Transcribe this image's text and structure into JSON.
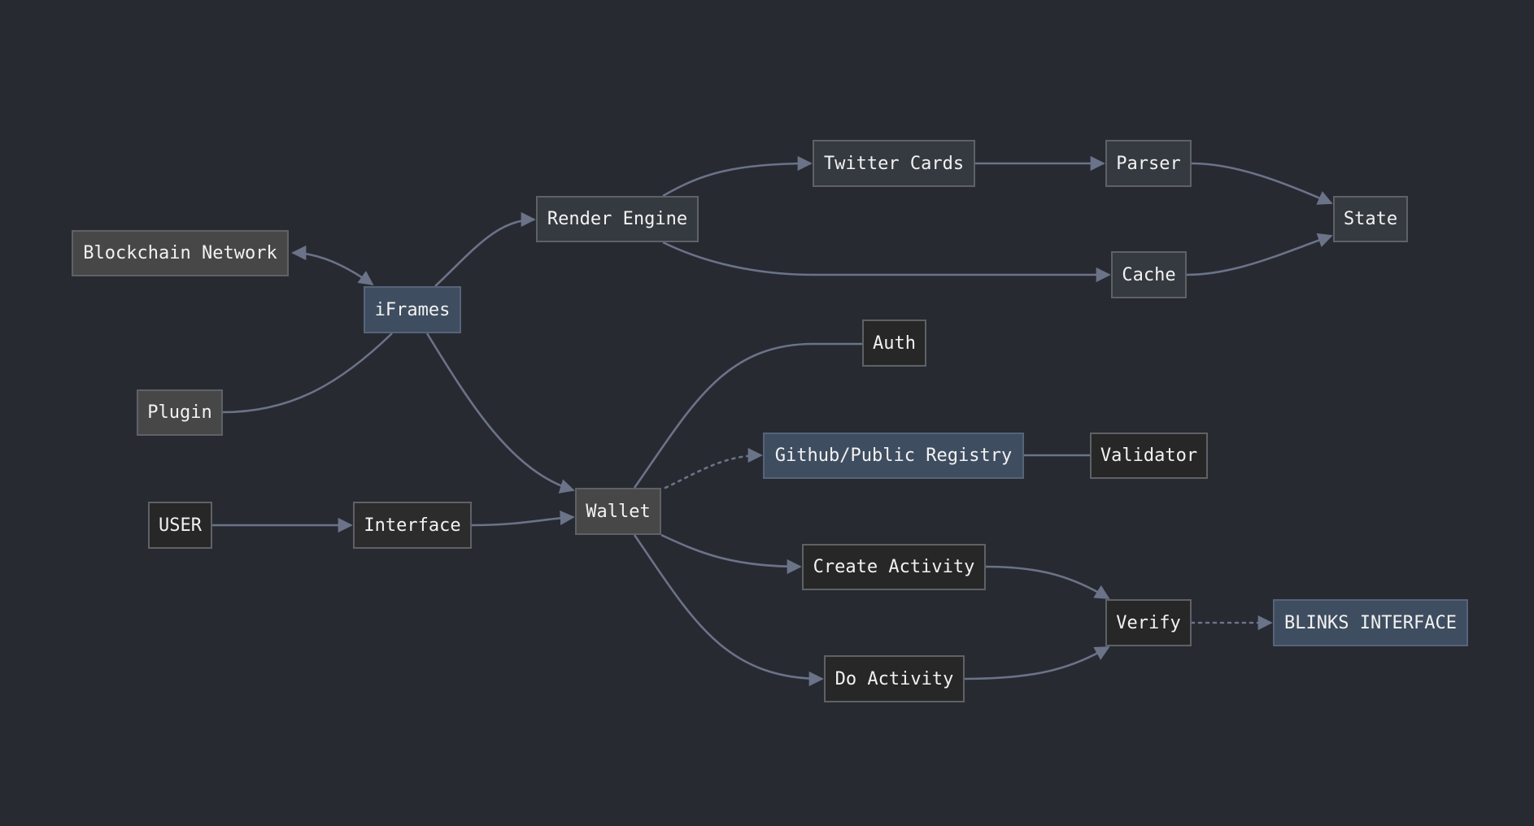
{
  "nodes": {
    "blockchain": "Blockchain Network",
    "iframes": "iFrames",
    "plugin": "Plugin",
    "user": "USER",
    "interface": "Interface",
    "wallet": "Wallet",
    "render": "Render Engine",
    "twitter": "Twitter Cards",
    "parser": "Parser",
    "state": "State",
    "cache": "Cache",
    "auth": "Auth",
    "github": "Github/Public Registry",
    "validator": "Validator",
    "create": "Create Activity",
    "verify": "Verify",
    "do": "Do Activity",
    "blinks": "BLINKS INTERFACE"
  },
  "edges": [
    {
      "from": "iFrames",
      "to": "Blockchain Network",
      "style": "solid",
      "arrow": "both"
    },
    {
      "from": "Plugin",
      "to": "iFrames",
      "style": "solid",
      "arrow": "none"
    },
    {
      "from": "iFrames",
      "to": "Render Engine",
      "style": "solid",
      "arrow": "end"
    },
    {
      "from": "iFrames",
      "to": "Wallet",
      "style": "solid",
      "arrow": "end"
    },
    {
      "from": "Render Engine",
      "to": "Twitter Cards",
      "style": "solid",
      "arrow": "end"
    },
    {
      "from": "Render Engine",
      "to": "Cache",
      "style": "solid",
      "arrow": "end"
    },
    {
      "from": "Twitter Cards",
      "to": "Parser",
      "style": "solid",
      "arrow": "end"
    },
    {
      "from": "Parser",
      "to": "State",
      "style": "solid",
      "arrow": "end"
    },
    {
      "from": "Cache",
      "to": "State",
      "style": "solid",
      "arrow": "end"
    },
    {
      "from": "USER",
      "to": "Interface",
      "style": "solid",
      "arrow": "end"
    },
    {
      "from": "Interface",
      "to": "Wallet",
      "style": "solid",
      "arrow": "end"
    },
    {
      "from": "Wallet",
      "to": "Auth",
      "style": "solid",
      "arrow": "none"
    },
    {
      "from": "Wallet",
      "to": "Github/Public Registry",
      "style": "dotted",
      "arrow": "end"
    },
    {
      "from": "Github/Public Registry",
      "to": "Validator",
      "style": "solid",
      "arrow": "none"
    },
    {
      "from": "Wallet",
      "to": "Create Activity",
      "style": "solid",
      "arrow": "end"
    },
    {
      "from": "Wallet",
      "to": "Do Activity",
      "style": "solid",
      "arrow": "end"
    },
    {
      "from": "Create Activity",
      "to": "Verify",
      "style": "solid",
      "arrow": "end"
    },
    {
      "from": "Do Activity",
      "to": "Verify",
      "style": "solid",
      "arrow": "end"
    },
    {
      "from": "Verify",
      "to": "BLINKS INTERFACE",
      "style": "dotted",
      "arrow": "end"
    }
  ],
  "colors": {
    "background": "#282a32",
    "edge": "#6b7388",
    "node_grey": "#474747",
    "node_blue": "#3f4d60",
    "node_slate": "#353a40",
    "node_dark": "#272727"
  }
}
